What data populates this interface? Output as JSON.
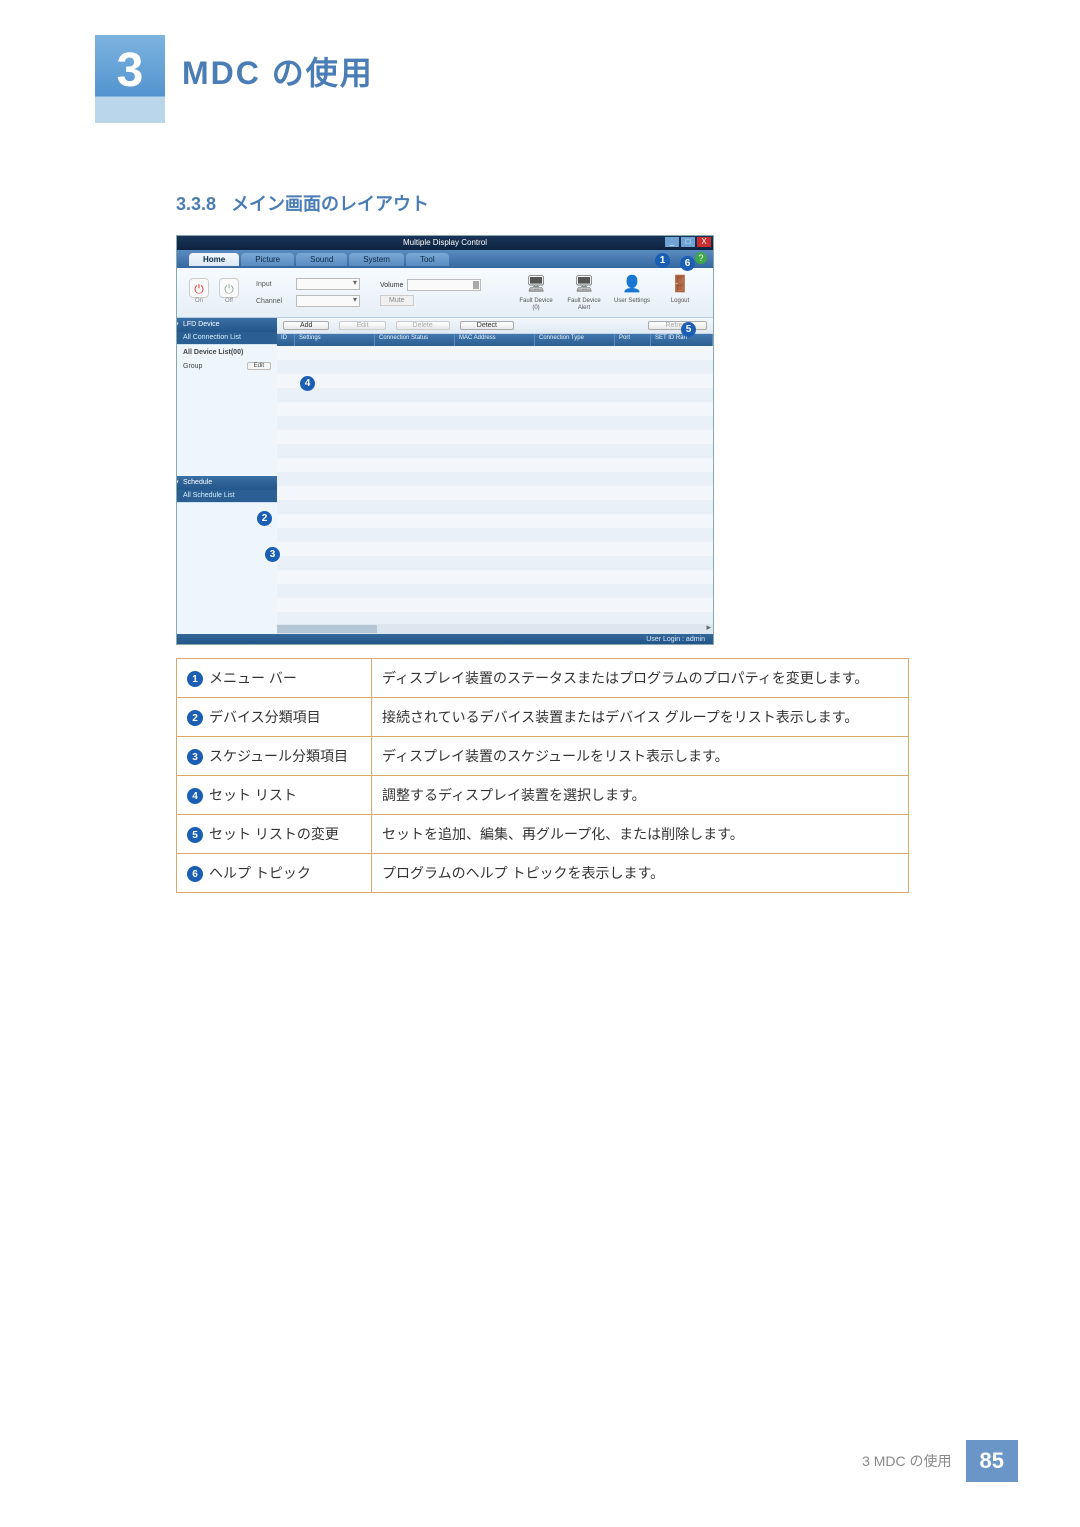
{
  "chapter": {
    "num": "3",
    "title": "MDC の使用"
  },
  "section": {
    "num": "3.3.8",
    "title": "メイン画面のレイアウト"
  },
  "app": {
    "window_title": "Multiple Display Control",
    "winbtns": {
      "min": "_",
      "max": "□",
      "close": "X"
    },
    "tabs": [
      "Home",
      "Picture",
      "Sound",
      "System",
      "Tool"
    ],
    "help_glyph": "?",
    "power": {
      "on": "On",
      "off": "Off",
      "glyph": "⏻"
    },
    "input": {
      "label": "Input",
      "channel_label": "Channel"
    },
    "volume": {
      "label": "Volume",
      "mute": "Mute"
    },
    "right_icons": [
      {
        "icon": "🖥",
        "over": "⚠",
        "label": "Fault Device (0)"
      },
      {
        "icon": "🖥",
        "over": "⚠",
        "label": "Fault Device Alert"
      },
      {
        "icon": "👤",
        "over": "",
        "label": "User Settings"
      },
      {
        "icon": "🚪",
        "over": "",
        "label": "Logout"
      }
    ],
    "side": {
      "lfd_header": "LFD Device",
      "all_conn": "All Connection List",
      "all_dev_title": "All Device List(00)",
      "group_label": "Group",
      "edit_label": "Edit",
      "sched_header": "Schedule",
      "all_sched": "All Schedule List"
    },
    "actionbar": {
      "add": "Add",
      "edit": "Edit",
      "delete": "Delete",
      "detect": "Detect",
      "refresh": "Refresh"
    },
    "columns": [
      "ID",
      "Settings",
      "Connection Status",
      "MAC Address",
      "Connection Type",
      "Port",
      "SET ID Ran"
    ],
    "status": "User Login : admin"
  },
  "callouts": {
    "c1": "1",
    "c2": "2",
    "c3": "3",
    "c4": "4",
    "c5": "5",
    "c6": "6"
  },
  "legend": [
    {
      "n": "1",
      "label": "メニュー バー",
      "desc": "ディスプレイ装置のステータスまたはプログラムのプロパティを変更します。"
    },
    {
      "n": "2",
      "label": "デバイス分類項目",
      "desc": "接続されているデバイス装置またはデバイス グループをリスト表示します。"
    },
    {
      "n": "3",
      "label": "スケジュール分類項目",
      "desc": "ディスプレイ装置のスケジュールをリスト表示します。"
    },
    {
      "n": "4",
      "label": "セット リスト",
      "desc": "調整するディスプレイ装置を選択します。"
    },
    {
      "n": "5",
      "label": "セット リストの変更",
      "desc": "セットを追加、編集、再グループ化、または削除します。"
    },
    {
      "n": "6",
      "label": "ヘルプ トピック",
      "desc": "プログラムのヘルプ トピックを表示します。"
    }
  ],
  "footer": {
    "chapter_ref": "3 MDC の使用",
    "page": "85"
  }
}
